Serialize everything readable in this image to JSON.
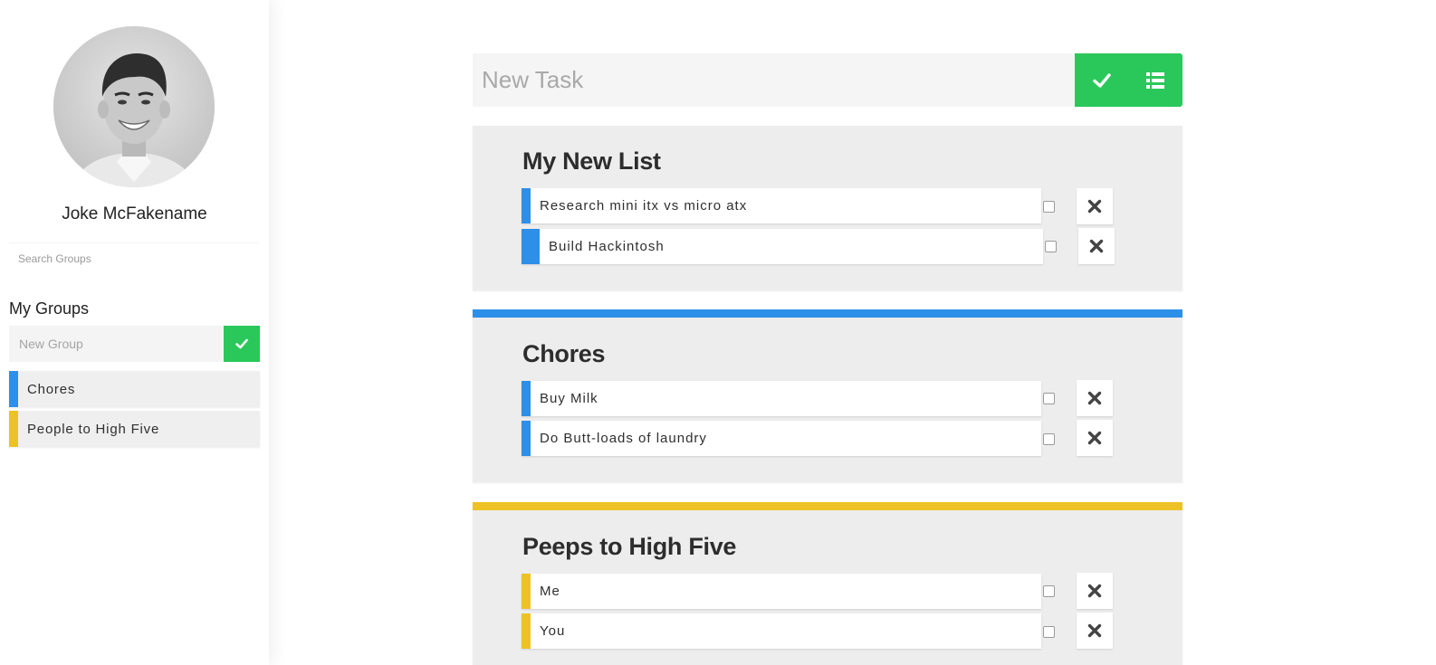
{
  "colors": {
    "accent_green": "#2ac85a",
    "blue": "#2d8fe8",
    "yellow": "#ecc226",
    "card_bg": "#ededed"
  },
  "sidebar": {
    "user_name": "Joke McFakename",
    "search_placeholder": "Search Groups",
    "groups_title": "My Groups",
    "new_group_placeholder": "New Group",
    "groups": [
      {
        "label": "Chores",
        "color": "#2d8fe8"
      },
      {
        "label": "People to High Five",
        "color": "#ecc226"
      }
    ]
  },
  "main": {
    "new_task_placeholder": "New Task",
    "icons": {
      "confirm": "check-icon",
      "lists": "list-icon",
      "delete": "close-icon"
    },
    "lists": [
      {
        "title": "My New List",
        "color": null,
        "tasks": [
          {
            "text": "Research mini itx vs micro atx",
            "color": "#2d8fe8",
            "checked": false
          },
          {
            "text": "Build Hackintosh",
            "color": "#2d8fe8",
            "checked": false
          }
        ]
      },
      {
        "title": "Chores",
        "color": "#2d8fe8",
        "tasks": [
          {
            "text": "Buy Milk",
            "color": "#2d8fe8",
            "checked": false
          },
          {
            "text": "Do Butt-loads of laundry",
            "color": "#2d8fe8",
            "checked": false
          }
        ]
      },
      {
        "title": "Peeps to High Five",
        "color": "#ecc226",
        "tasks": [
          {
            "text": "Me",
            "color": "#ecc226",
            "checked": false
          },
          {
            "text": "You",
            "color": "#ecc226",
            "checked": false
          }
        ]
      }
    ]
  }
}
